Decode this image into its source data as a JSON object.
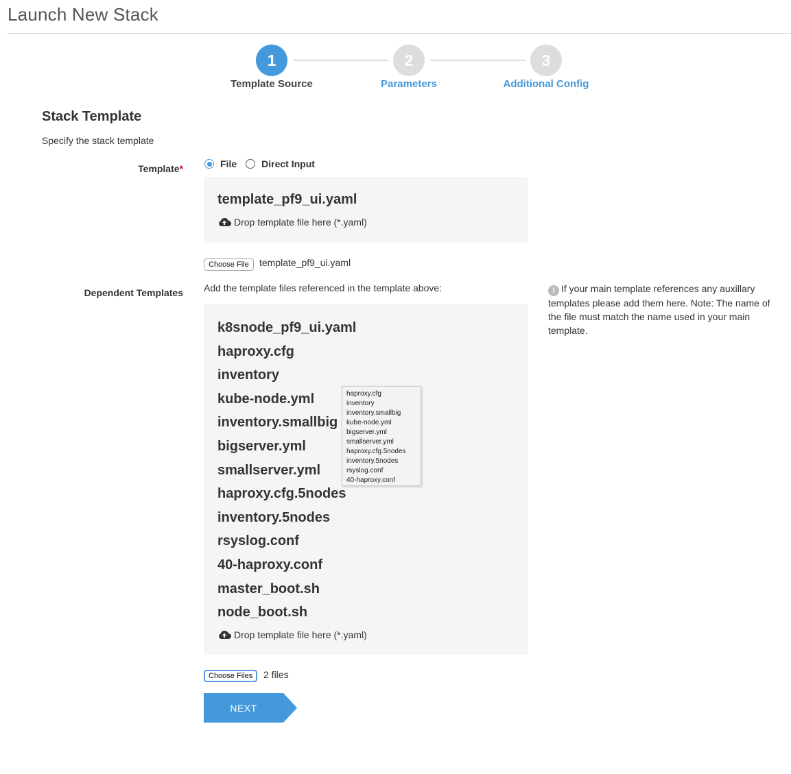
{
  "page": {
    "title": "Launch New Stack"
  },
  "stepper": {
    "steps": [
      {
        "number": "1",
        "label": "Template Source",
        "active": true
      },
      {
        "number": "2",
        "label": "Parameters",
        "active": false
      },
      {
        "number": "3",
        "label": "Additional Config",
        "active": false
      }
    ]
  },
  "section": {
    "title": "Stack Template",
    "subtitle": "Specify the stack template"
  },
  "template": {
    "label": "Template",
    "required_mark": "*",
    "options": [
      "File",
      "Direct Input"
    ],
    "selected": "File",
    "dropzone_file": "template_pf9_ui.yaml",
    "drop_hint": "Drop template file here (*.yaml)",
    "choose_button": "Choose File",
    "chosen_file": "template_pf9_ui.yaml"
  },
  "dependent": {
    "label": "Dependent Templates",
    "intro": "Add the template files referenced in the template above:",
    "files": [
      "k8snode_pf9_ui.yaml",
      "haproxy.cfg",
      "inventory",
      "kube-node.yml",
      "inventory.smallbig",
      "bigserver.yml",
      "smallserver.yml",
      "haproxy.cfg.5nodes",
      "inventory.5nodes",
      "rsyslog.conf",
      "40-haproxy.conf",
      "master_boot.sh",
      "node_boot.sh"
    ],
    "drop_hint": "Drop template file here (*.yaml)",
    "choose_button": "Choose Files",
    "chosen_status": "2 files",
    "tooltip_files": [
      "haproxy.cfg",
      "inventory",
      "inventory.smallbig",
      "kube-node.yml",
      "bigserver.yml",
      "smallserver.yml",
      "haproxy.cfg.5nodes",
      "inventory.5nodes",
      "rsyslog.conf",
      "40-haproxy.conf"
    ],
    "help_text": "If your main template references any auxillary templates please add them here. Note: The name of the file must match the name used in your main template."
  },
  "actions": {
    "next_label": "NEXT"
  },
  "colors": {
    "accent": "#4399db",
    "inactive_step": "#dddddd",
    "dropzone_bg": "#f5f5f5",
    "required": "#d0021b"
  }
}
